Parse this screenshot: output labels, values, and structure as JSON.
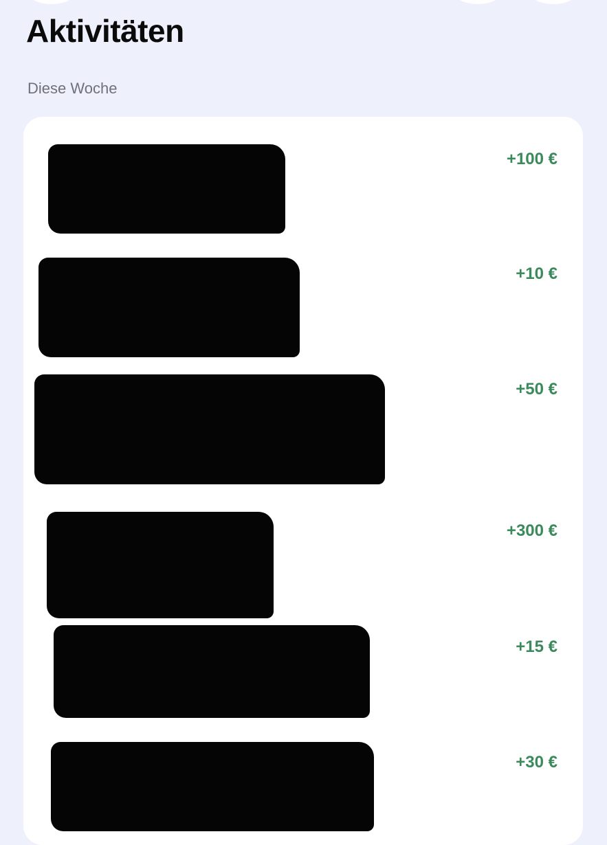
{
  "header": {
    "title": "Aktivitäten"
  },
  "section": {
    "label": "Diese Woche"
  },
  "transactions": [
    {
      "amount": "+100 €"
    },
    {
      "amount": "+10 €"
    },
    {
      "amount": "+50 €"
    },
    {
      "amount": "+300 €"
    },
    {
      "amount": "+15 €"
    },
    {
      "amount": "+30 €"
    }
  ],
  "colors": {
    "background": "#eef1fb",
    "card": "#ffffff",
    "amount_positive": "#3a8a5b",
    "redaction": "#050505"
  }
}
